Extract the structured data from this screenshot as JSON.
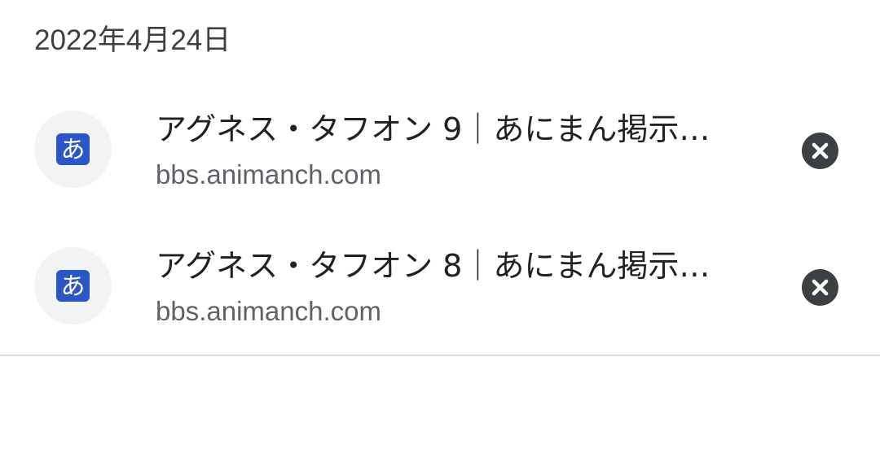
{
  "history": {
    "date_header": "2022年4月24日",
    "items": [
      {
        "title": "アグネス・タフオン 9｜あにまん掲示…",
        "url": "bbs.animanch.com",
        "favicon_glyph": "あ",
        "favicon_icon": "animanch-favicon-icon",
        "remove_icon": "close-circle-icon"
      },
      {
        "title": "アグネス・タフオン 8｜あにまん掲示…",
        "url": "bbs.animanch.com",
        "favicon_glyph": "あ",
        "favicon_icon": "animanch-favicon-icon",
        "remove_icon": "close-circle-icon"
      }
    ]
  },
  "colors": {
    "favicon_blue": "#2a56c6",
    "favicon_bg": "#f1f3f4",
    "remove_button": "#3c4043",
    "title_text": "#202124",
    "url_text": "#5f6368",
    "divider": "#dadce0"
  }
}
